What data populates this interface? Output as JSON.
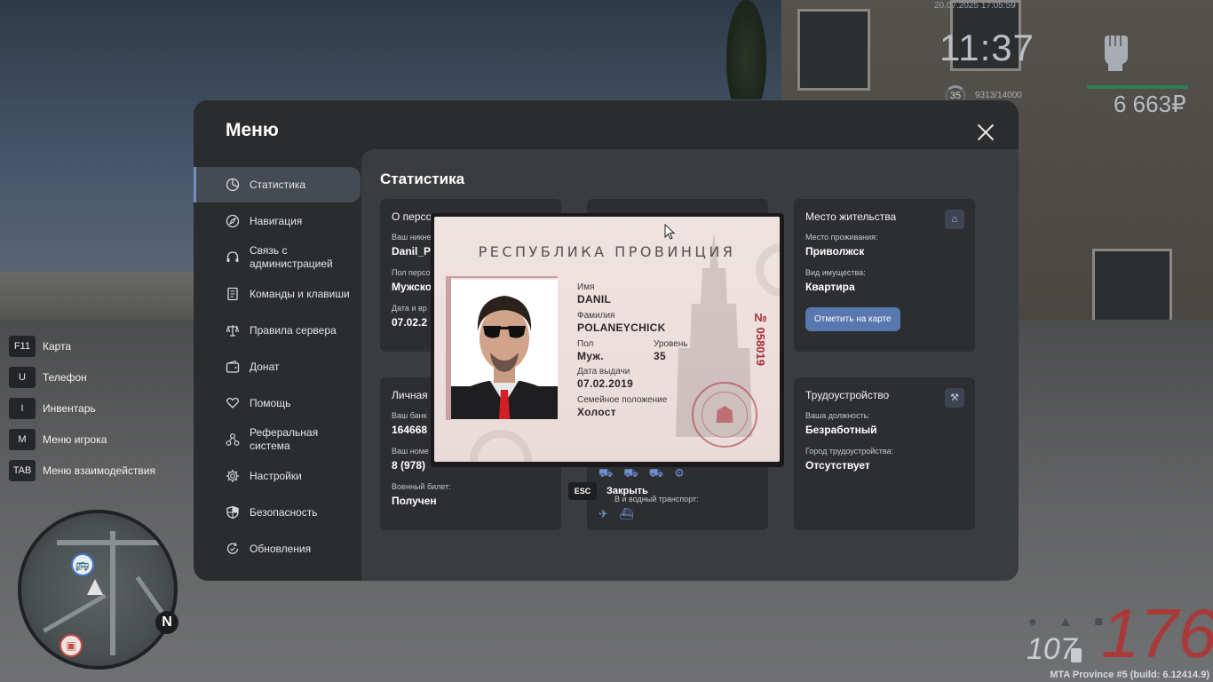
{
  "hud": {
    "datetime": "20.07.2025 17:05:59",
    "clock": "11:37",
    "level": "35",
    "xp": "9313/14000",
    "money": "6 663₽",
    "speed": "176",
    "fuel": "107",
    "build": "MTA Province #5 (build: 6.12414.9)",
    "hotkeys": [
      {
        "key": "F11",
        "label": "Карта"
      },
      {
        "key": "U",
        "label": "Телефон"
      },
      {
        "key": "I",
        "label": "Инвентарь"
      },
      {
        "key": "M",
        "label": "Меню игрока"
      },
      {
        "key": "TAB",
        "label": "Меню взаимодействия"
      }
    ],
    "map_north": "N"
  },
  "menu": {
    "title": "Меню",
    "sidebar": [
      {
        "label": "Статистика",
        "icon": "stats-icon",
        "active": true
      },
      {
        "label": "Навигация",
        "icon": "compass-icon"
      },
      {
        "label": "Связь с администрацией",
        "icon": "headset-icon"
      },
      {
        "label": "Команды и клавиши",
        "icon": "document-icon"
      },
      {
        "label": "Правила сервера",
        "icon": "scales-icon"
      },
      {
        "label": "Донат",
        "icon": "wallet-icon"
      },
      {
        "label": "Помощь",
        "icon": "heart-hand-icon"
      },
      {
        "label": "Реферальная система",
        "icon": "referral-icon"
      },
      {
        "label": "Настройки",
        "icon": "gear-icon"
      },
      {
        "label": "Безопасность",
        "icon": "shield-icon"
      },
      {
        "label": "Обновления",
        "icon": "update-icon"
      }
    ],
    "content_title": "Статистика",
    "cards": {
      "about": {
        "title": "О персо",
        "f1_label": "Ваш никне",
        "f1_value": "Danil_P",
        "f2_label": "Пол персо",
        "f2_value": "Мужско",
        "f3_label": "Дата и вр",
        "f3_value": "07.02.2"
      },
      "residence": {
        "title": "Место жительства",
        "f1_label": "Место проживания:",
        "f1_value": "Приволжск",
        "f2_label": "Вид имущества:",
        "f2_value": "Квартира",
        "button": "Отметить на карте"
      },
      "personal": {
        "title": "Личная",
        "f1_label": "Ваш банк",
        "f1_value": "164668",
        "f2_label": "Ваш номе",
        "f2_value": "8 (978)",
        "f3_label": "Военный билет:",
        "f3_value": "Получен"
      },
      "transport": {
        "label": "В     и водный транспорт:"
      },
      "job": {
        "title": "Трудоустройство",
        "f1_label": "Ваша должность:",
        "f1_value": "Безработный",
        "f2_label": "Город трудоустройства:",
        "f2_value": "Отсутствует"
      }
    }
  },
  "passport": {
    "title": "РЕСПУБЛИКА ПРОВИНЦИЯ",
    "name_label": "Имя",
    "name_value": "DANIL",
    "surname_label": "Фамилия",
    "surname_value": "POLANEYCHICK",
    "sex_label": "Пол",
    "sex_value": "Муж.",
    "level_label": "Уровень",
    "level_value": "35",
    "issue_label": "Дата выдачи",
    "issue_value": "07.02.2019",
    "family_label": "Семейное положение",
    "family_value": "Холост",
    "number": "№ 058019"
  },
  "close_hint": {
    "key": "ESC",
    "label": "Закрыть"
  },
  "colors": {
    "accent": "#5777ae",
    "menu_bg": "#2b2c2e",
    "content_bg": "#3b3c3f",
    "speed": "#b53030",
    "passport_red": "#a82c35"
  }
}
